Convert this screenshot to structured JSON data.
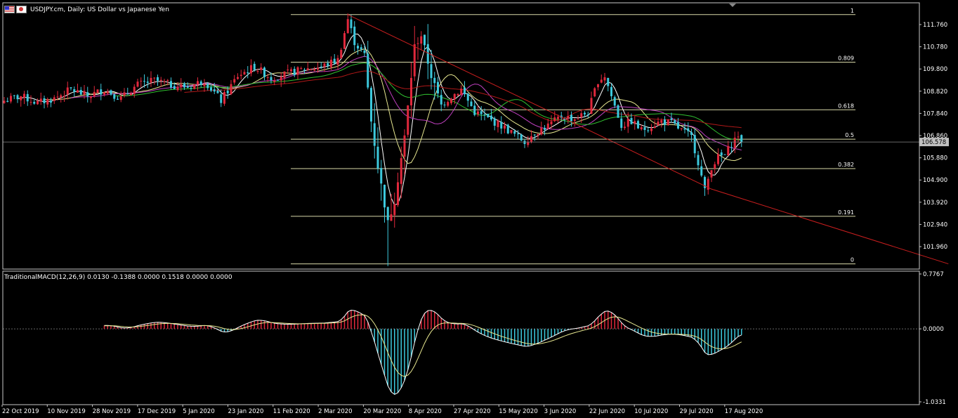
{
  "window": {
    "symbol": "USDJPY.cm",
    "timeframe": "Daily",
    "description": "US Dollar vs Japanese Yen",
    "title": "USDJPY.cm, Daily:  US Dollar vs Japanese Yen",
    "icons": [
      "us-flag-icon",
      "japan-flag-icon",
      "scroll-marker-icon"
    ]
  },
  "colors": {
    "background": "#000000",
    "frame": "#c8c8c8",
    "bull_candle": "#e0283c",
    "bear_candle": "#3cc8dc",
    "fib": "#d8d8a8",
    "trendline": "#c81e1e",
    "ma_white": "#ffffff",
    "ma_yellow": "#e8e890",
    "ma_green": "#30c030",
    "ma_magenta": "#c040c0",
    "ma_red": "#b01818",
    "macd_signal": "#e8e890",
    "price_tag_bg": "#c0c0c0"
  },
  "chart_data": [
    {
      "type": "line",
      "panel": "price",
      "x_labels": [
        "22 Oct 2019",
        "10 Nov 2019",
        "28 Nov 2019",
        "17 Dec 2019",
        "5 Jan 2020",
        "23 Jan 2020",
        "11 Feb 2020",
        "2 Mar 2020",
        "20 Mar 2020",
        "8 Apr 2020",
        "27 Apr 2020",
        "15 May 2020",
        "3 Jun 2020",
        "22 Jun 2020",
        "10 Jul 2020",
        "29 Jul 2020",
        "17 Aug 2020"
      ],
      "y_ticks": [
        "111.760",
        "110.780",
        "109.800",
        "108.820",
        "107.840",
        "106.860",
        "105.880",
        "104.900",
        "103.920",
        "102.940",
        "101.960"
      ],
      "ylim": [
        100.97,
        112.72
      ],
      "current_price": "106.578",
      "candle_count": 214,
      "anchors": [
        {
          "i": 0,
          "close": 108.4
        },
        {
          "i": 5,
          "close": 108.6
        },
        {
          "i": 10,
          "close": 108.3
        },
        {
          "i": 15,
          "close": 108.5
        },
        {
          "i": 20,
          "close": 108.9
        },
        {
          "i": 25,
          "close": 108.6
        },
        {
          "i": 30,
          "close": 108.9
        },
        {
          "i": 35,
          "close": 108.5
        },
        {
          "i": 40,
          "close": 109.1
        },
        {
          "i": 45,
          "close": 109.3
        },
        {
          "i": 50,
          "close": 109.1
        },
        {
          "i": 55,
          "close": 109.0
        },
        {
          "i": 60,
          "close": 109.3
        },
        {
          "i": 65,
          "close": 108.4
        },
        {
          "i": 70,
          "close": 109.5
        },
        {
          "i": 75,
          "close": 109.9
        },
        {
          "i": 80,
          "close": 109.4
        },
        {
          "i": 85,
          "close": 109.6
        },
        {
          "i": 90,
          "close": 109.8
        },
        {
          "i": 95,
          "close": 109.9
        },
        {
          "i": 100,
          "close": 110.2
        },
        {
          "i": 103,
          "close": 112.0
        },
        {
          "i": 105,
          "close": 111.0
        },
        {
          "i": 108,
          "close": 110.4
        },
        {
          "i": 110,
          "close": 107.5
        },
        {
          "i": 112,
          "close": 105.5
        },
        {
          "i": 115,
          "close": 103.0
        },
        {
          "i": 117,
          "close": 104.0
        },
        {
          "i": 120,
          "close": 106.8
        },
        {
          "i": 123,
          "close": 110.8
        },
        {
          "i": 125,
          "close": 111.3
        },
        {
          "i": 128,
          "close": 109.5
        },
        {
          "i": 131,
          "close": 108.2
        },
        {
          "i": 134,
          "close": 108.6
        },
        {
          "i": 137,
          "close": 108.9
        },
        {
          "i": 141,
          "close": 107.9
        },
        {
          "i": 145,
          "close": 107.6
        },
        {
          "i": 149,
          "close": 107.3
        },
        {
          "i": 153,
          "close": 106.9
        },
        {
          "i": 156,
          "close": 106.6
        },
        {
          "i": 159,
          "close": 107.0
        },
        {
          "i": 163,
          "close": 107.3
        },
        {
          "i": 167,
          "close": 107.7
        },
        {
          "i": 171,
          "close": 107.6
        },
        {
          "i": 175,
          "close": 107.9
        },
        {
          "i": 178,
          "close": 109.3
        },
        {
          "i": 180,
          "close": 109.5
        },
        {
          "i": 182,
          "close": 108.6
        },
        {
          "i": 185,
          "close": 107.3
        },
        {
          "i": 188,
          "close": 107.5
        },
        {
          "i": 191,
          "close": 107.1
        },
        {
          "i": 194,
          "close": 107.3
        },
        {
          "i": 197,
          "close": 107.5
        },
        {
          "i": 200,
          "close": 107.4
        },
        {
          "i": 203,
          "close": 107.1
        },
        {
          "i": 206,
          "close": 106.8
        },
        {
          "i": 208,
          "close": 105.7
        },
        {
          "i": 210,
          "close": 104.4
        },
        {
          "i": 212,
          "close": 105.5
        },
        {
          "i": 214,
          "close": 105.9
        },
        {
          "i": 216,
          "close": 106.0
        },
        {
          "i": 218,
          "close": 106.5
        },
        {
          "i": 220,
          "close": 106.9
        },
        {
          "i": 221,
          "close": 106.58
        }
      ],
      "fibonacci": {
        "high_price": 112.2,
        "low_price": 101.2,
        "levels": [
          {
            "ratio": 1,
            "label": "1"
          },
          {
            "ratio": 0.809,
            "label": "0.809"
          },
          {
            "ratio": 0.618,
            "label": "0.618"
          },
          {
            "ratio": 0.5,
            "label": "0.5"
          },
          {
            "ratio": 0.382,
            "label": "0.382"
          },
          {
            "ratio": 0.191,
            "label": "0.191"
          },
          {
            "ratio": 0,
            "label": "0"
          }
        ]
      },
      "trendlines": [
        {
          "from": {
            "date_index": 103,
            "price": 112.2
          },
          "to": {
            "date_index": 212,
            "price": 104.5
          }
        },
        {
          "from": {
            "date_index": 212,
            "price": 104.5
          },
          "to": {
            "date_index": 283,
            "price": 101.2
          }
        }
      ],
      "moving_averages": [
        {
          "color_key": "ma_white",
          "period": 5
        },
        {
          "color_key": "ma_yellow",
          "period": 13
        },
        {
          "color_key": "ma_magenta",
          "period": 21
        },
        {
          "color_key": "ma_green",
          "period": 34
        },
        {
          "color_key": "ma_red",
          "period": 55
        }
      ]
    },
    {
      "type": "bar",
      "panel": "indicator",
      "title": "TraditionalMACD(12,26,9) 0.0130 -0.1388 0.0000 0.1518 0.0000 0.0000",
      "y_ticks": [
        "0.7767",
        "0.0000",
        "-1.0331"
      ],
      "ylim": [
        -1.0331,
        0.7767
      ],
      "series": [
        {
          "name": "",
          "kind": "histogram"
        },
        {
          "name": "",
          "kind": "macd_line"
        },
        {
          "name": "",
          "kind": "signal_line"
        }
      ]
    }
  ]
}
